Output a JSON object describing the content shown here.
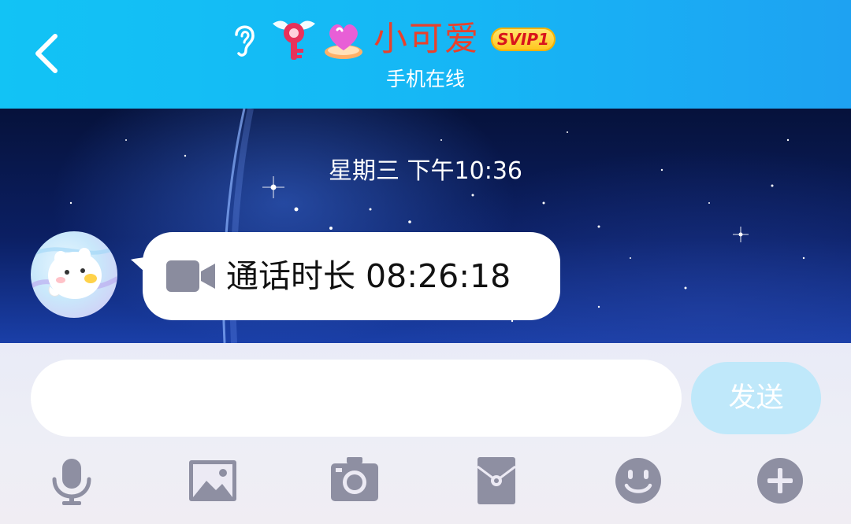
{
  "header": {
    "contact_name": "小可爱",
    "badge": "SVIP1",
    "status": "手机在线",
    "icons": [
      "back-icon",
      "ear-icon",
      "key-icon",
      "heart-icon"
    ]
  },
  "chat": {
    "timestamp": "星期三 下午10:36",
    "messages": [
      {
        "sender": "contact",
        "type": "video-call",
        "icon": "video-camera-icon",
        "text": "通话时长 08:26:18"
      }
    ]
  },
  "input": {
    "value": "",
    "placeholder": "",
    "send_label": "发送"
  },
  "toolbar": {
    "items": [
      "microphone-icon",
      "image-icon",
      "camera-icon",
      "red-packet-icon",
      "emoji-icon",
      "plus-icon"
    ]
  },
  "colors": {
    "header_bg": "#16b6f5",
    "name_color": "#e8412c",
    "send_button_bg": "#bfe8fa",
    "toolbar_icon": "#8e8fa2"
  }
}
